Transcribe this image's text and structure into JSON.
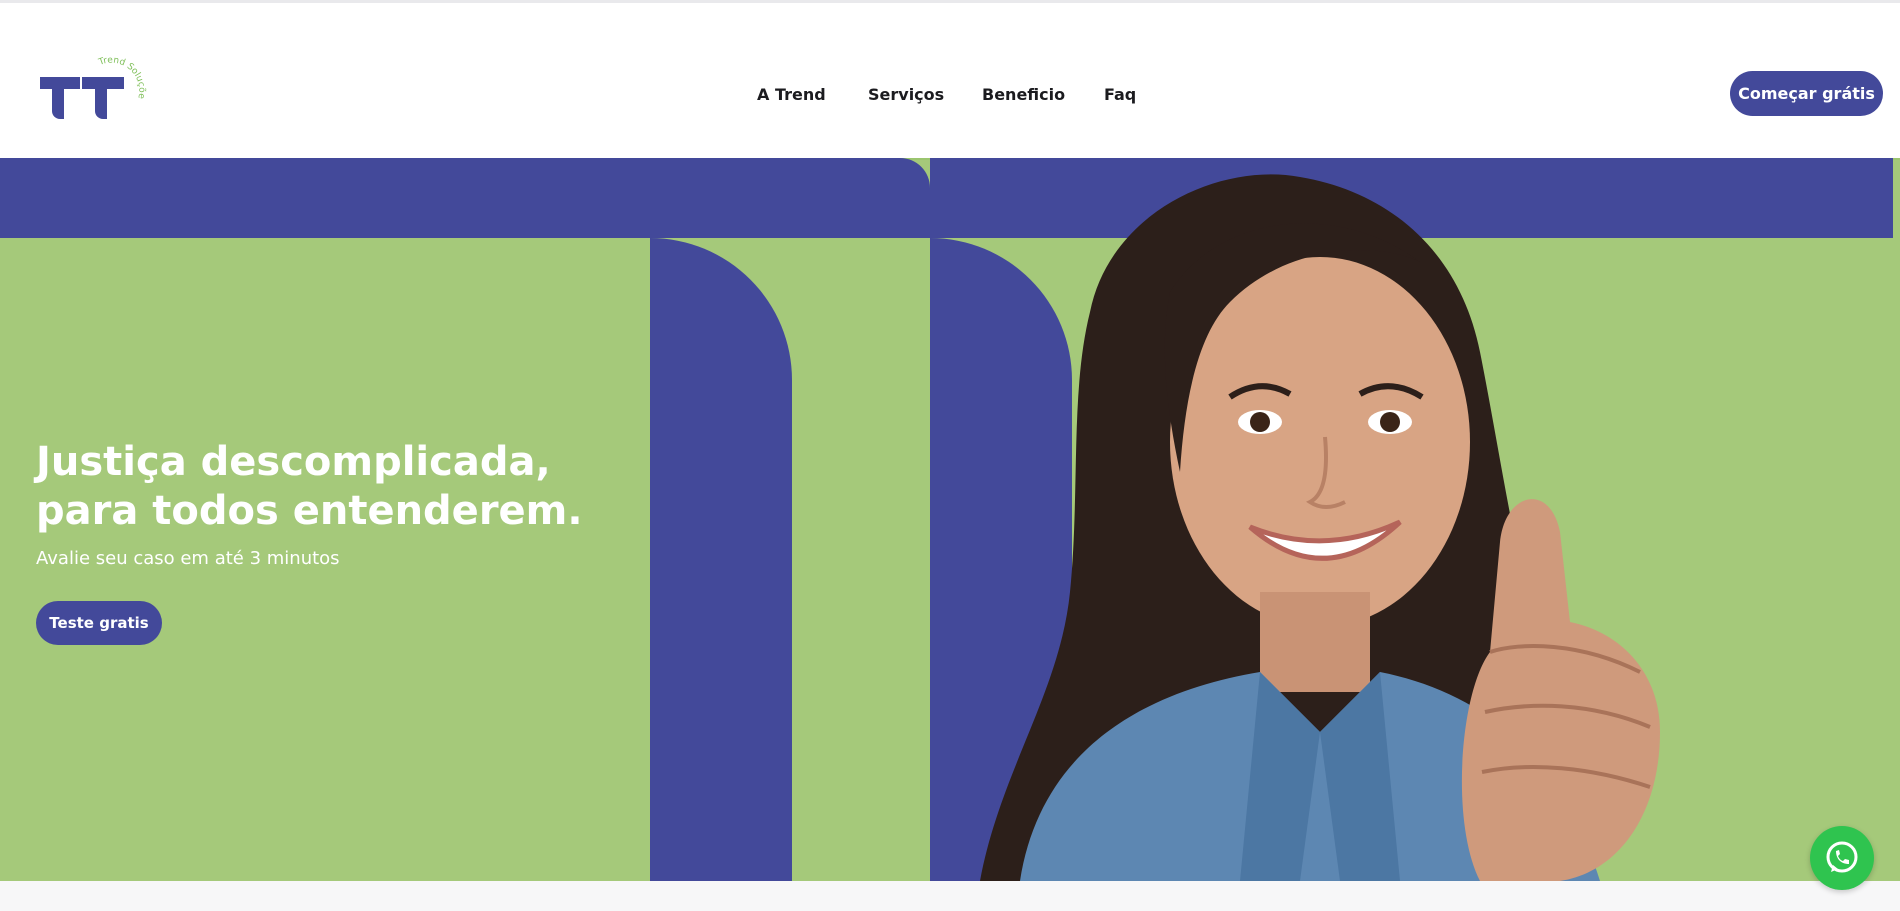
{
  "brand": {
    "name": "Trend Soluções",
    "arc_text": "Trend Soluções",
    "logo_color": "#43499a",
    "accent_green": "#a5c97a"
  },
  "nav": {
    "items": [
      {
        "label": "A Trend"
      },
      {
        "label": "Serviços"
      },
      {
        "label": "Beneficio"
      },
      {
        "label": "Faq"
      }
    ],
    "cta_label": "Começar grátis"
  },
  "hero": {
    "title_line1": "Justiça descomplicada,",
    "title_line2": "para todos entenderem.",
    "subtitle": "Avalie seu caso em até 3 minutos",
    "cta_label": "Teste gratis",
    "photo_alt_icon": "person-thumbs-up-photo"
  },
  "floating": {
    "whatsapp_icon": "whatsapp-icon"
  },
  "colors": {
    "primary": "#43499a",
    "hero_bg": "#a5c97a",
    "whatsapp": "#2fc44f"
  }
}
